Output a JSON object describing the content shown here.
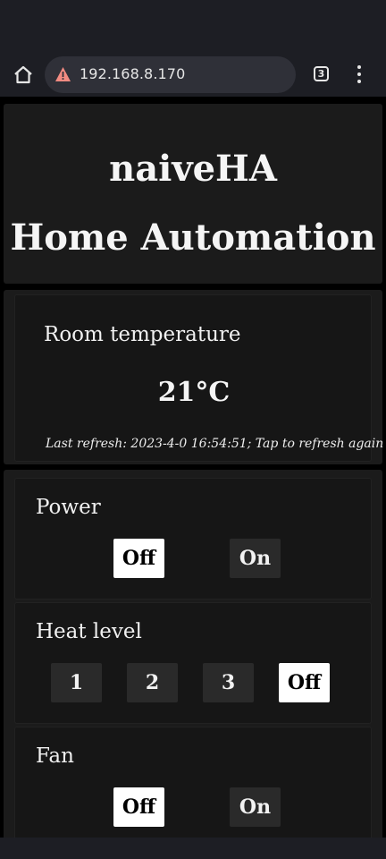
{
  "browser": {
    "url": "192.168.8.170",
    "tab_count": "3"
  },
  "header": {
    "title": "naiveHA",
    "subtitle": "Home Automation"
  },
  "temperature": {
    "label": "Room temperature",
    "value": "21°C",
    "refresh_text": "Last refresh: 2023-4-0 16:54:51; Tap to refresh again"
  },
  "controls": {
    "power": {
      "label": "Power",
      "options": [
        "Off",
        "On"
      ],
      "selected": "Off"
    },
    "heat": {
      "label": "Heat level",
      "options": [
        "1",
        "2",
        "3",
        "Off"
      ],
      "selected": "Off"
    },
    "fan": {
      "label": "Fan",
      "options": [
        "Off",
        "On"
      ],
      "selected": "Off"
    }
  },
  "colors": {
    "background": "#000000",
    "card": "#1b1b1b",
    "button": "#2a2a2a",
    "button_active": "#ffffff",
    "warning": "#f28b82"
  },
  "icons": [
    "home-icon",
    "warning-icon",
    "tabs-icon",
    "more-vert-icon"
  ]
}
